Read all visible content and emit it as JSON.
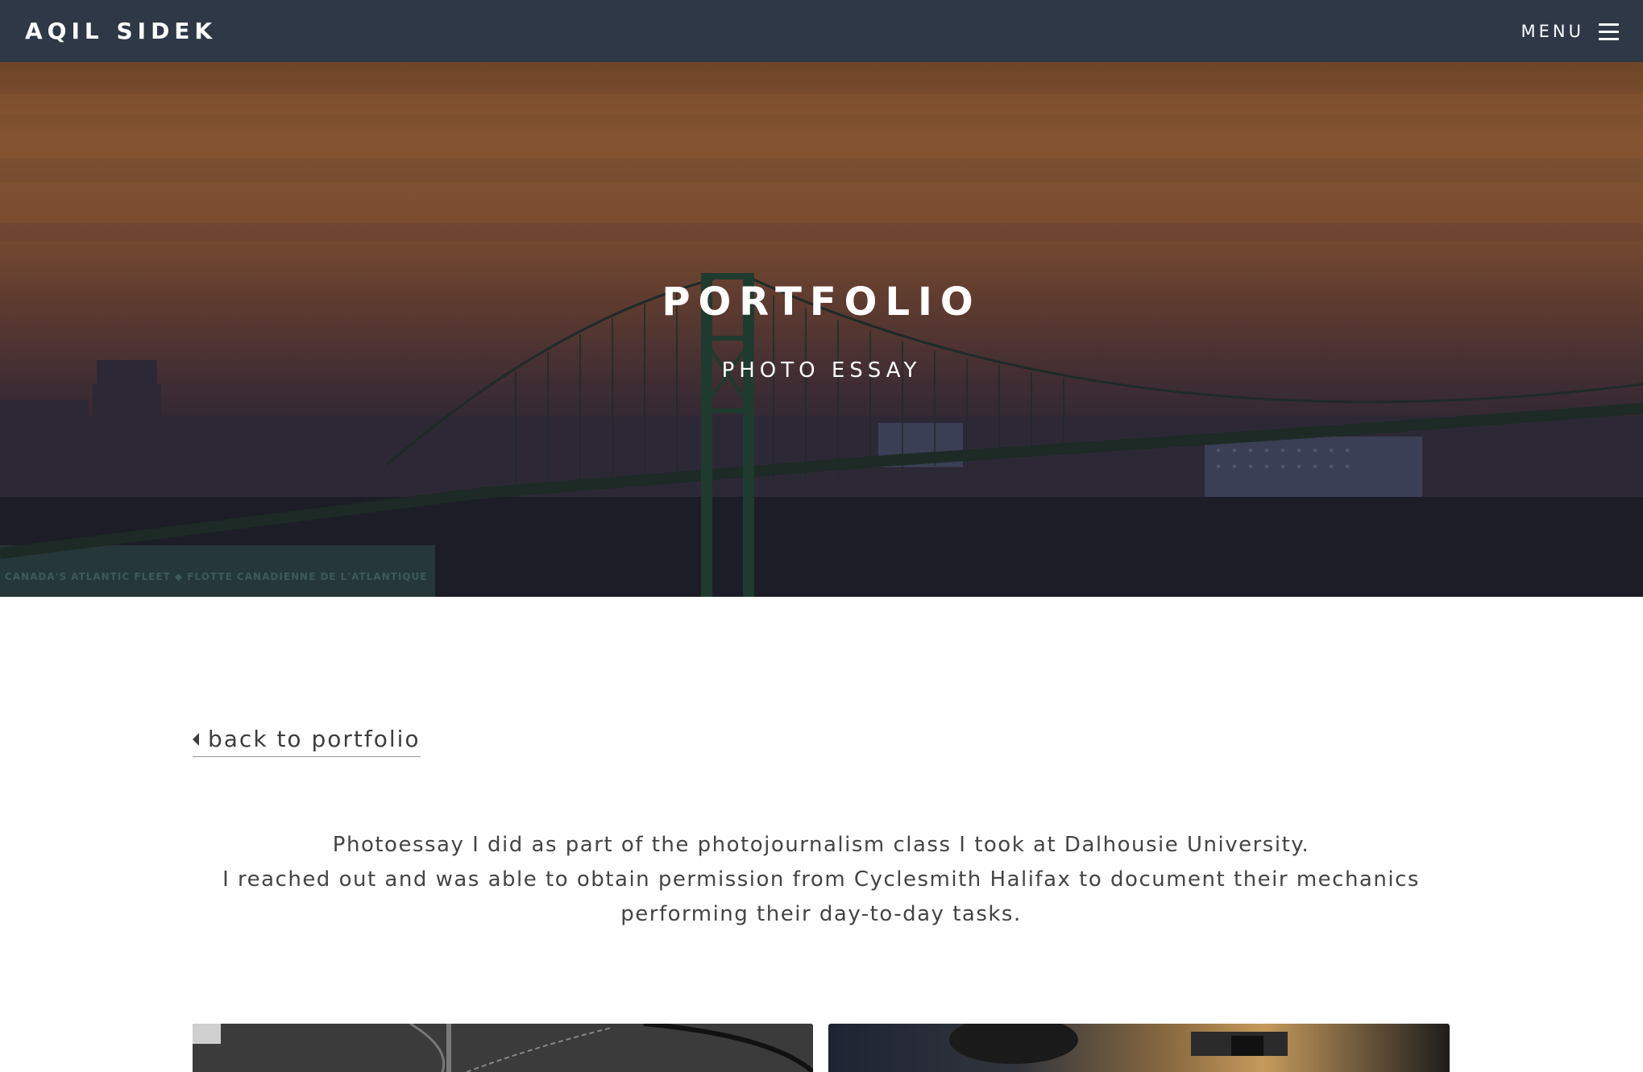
{
  "navbar": {
    "brand": "AQIL SIDEK",
    "menu_label": "MENU",
    "menu_icon": "hamburger-menu-icon"
  },
  "hero": {
    "title": "PORTFOLIO",
    "subtitle": "PHOTO ESSAY",
    "sign_text": "CANADA'S ATLANTIC FLEET ◆ FLOTTE CANADIENNE DE L'ATLANTIQUE"
  },
  "back_link": {
    "label": "back to portfolio",
    "icon": "caret-left-icon"
  },
  "intro": {
    "line1": "Photoessay I did as part of the photojournalism class I took at Dalhousie University.",
    "line2": "I reached out and was able to obtain permission from Cyclesmith Halifax to document their mechanics performing their day-to-day tasks."
  },
  "colors": {
    "navbar_bg": "#2e3846",
    "text": "#3d3d3d",
    "hero_sky_top": "#845431",
    "hero_sky_bottom": "#1e1c28"
  }
}
